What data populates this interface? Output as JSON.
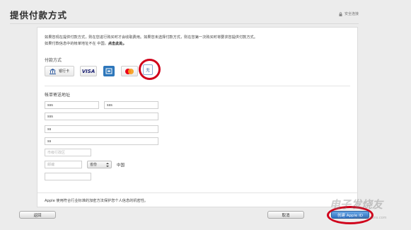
{
  "page": {
    "title": "提供付款方式",
    "secure_label": "安全连接"
  },
  "intro": {
    "line1": "如果您现在提供付款方式，则在您进行购买时才会收取费用。如果您未选择付款方式，则在您第一次购买时将要求您提供付款方式。",
    "line2_prefix": "如果付款信息中的帐单地址不在 中国，",
    "line2_link": "点击此处。"
  },
  "payment": {
    "section_title": "付款方式",
    "bank_label": "银行卡",
    "visa_label": "VISA",
    "none_label": "无"
  },
  "billing": {
    "section_title": "帐单寄送地址",
    "fields": {
      "first_name": "sss",
      "last_name": "sss",
      "street1": "sss",
      "street2": "ss",
      "street3": "ss",
      "city": "",
      "city_placeholder": "市级行政区",
      "postal": "",
      "postal_placeholder": "邮编",
      "province": "省份",
      "country": "中国",
      "phone": ""
    }
  },
  "footer_note": "Apple 使用符合行业标准的加密方法保护您个人信息的机密性。",
  "buttons": {
    "back": "返回",
    "cancel": "取消",
    "create": "创建 Apple ID"
  },
  "watermark": {
    "text": "电子发烧友",
    "url": "www.elecfans.com"
  },
  "colors": {
    "highlight_ring": "#d0011b",
    "primary_button": "#2e6fbf",
    "link": "#3b6ea8"
  }
}
